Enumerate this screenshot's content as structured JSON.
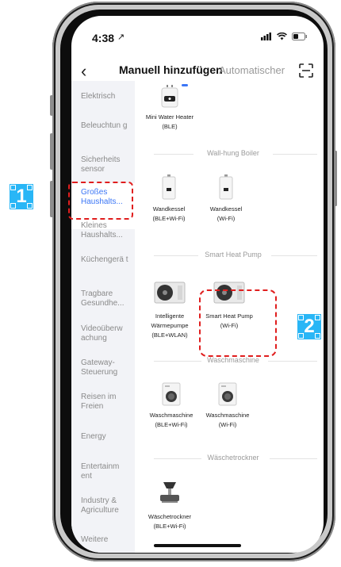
{
  "status_bar": {
    "time": "4:38",
    "location_arrow": "↗"
  },
  "header": {
    "tab_active": "Manuell hinzufügen",
    "tab_inactive": "Automatischer"
  },
  "sidebar": {
    "items": [
      {
        "label": "Elektrisch"
      },
      {
        "label": "Beleuchtun g"
      },
      {
        "label": "Sicherheits sensor"
      },
      {
        "label": "Großes Haushalts..."
      },
      {
        "label": "Kleines Haushalts..."
      },
      {
        "label": "Küchengerä t"
      },
      {
        "label": "Tragbare Gesundhe..."
      },
      {
        "label": "Videoüberw achung"
      },
      {
        "label": "Gateway- Steuerung"
      },
      {
        "label": "Reisen im Freien"
      },
      {
        "label": "Energy"
      },
      {
        "label": "Entertainm ent"
      },
      {
        "label": "Industry & Agriculture"
      },
      {
        "label": "Weitere"
      }
    ]
  },
  "content": {
    "top_device": {
      "name": "Mini Water Heater",
      "sub": "(BLE)"
    },
    "sections": {
      "wall_hung": "Wall-hung Boiler",
      "heat_pump": "Smart Heat Pump",
      "washer": "Waschmaschine",
      "dryer": "Wäschetrockner"
    },
    "devices": {
      "wandkessel_ble": {
        "name": "Wandkessel",
        "sub": "(BLE+Wi-Fi)"
      },
      "wandkessel_wifi": {
        "name": "Wandkessel",
        "sub": "(Wi-Fi)"
      },
      "waermepumpe": {
        "name": "Intelligente",
        "name2": "Wärmepumpe",
        "sub": "(BLE+WLAN)"
      },
      "heatpump_wifi": {
        "name": "Smart Heat Pump",
        "sub": "(Wi-Fi)"
      },
      "wasch_ble": {
        "name": "Waschmaschine",
        "sub": "(BLE+Wi-Fi)"
      },
      "wasch_wifi": {
        "name": "Waschmaschine",
        "sub": "(Wi-Fi)"
      },
      "trockner": {
        "name": "Wäschetrockner",
        "sub": "(BLE+Wi-Fi)"
      }
    }
  },
  "annotations": {
    "badge1": "1",
    "badge2": "2"
  },
  "colors": {
    "accent": "#3b76f6",
    "annotation_red": "#e01e1e",
    "badge_blue": "#29b6f6"
  }
}
